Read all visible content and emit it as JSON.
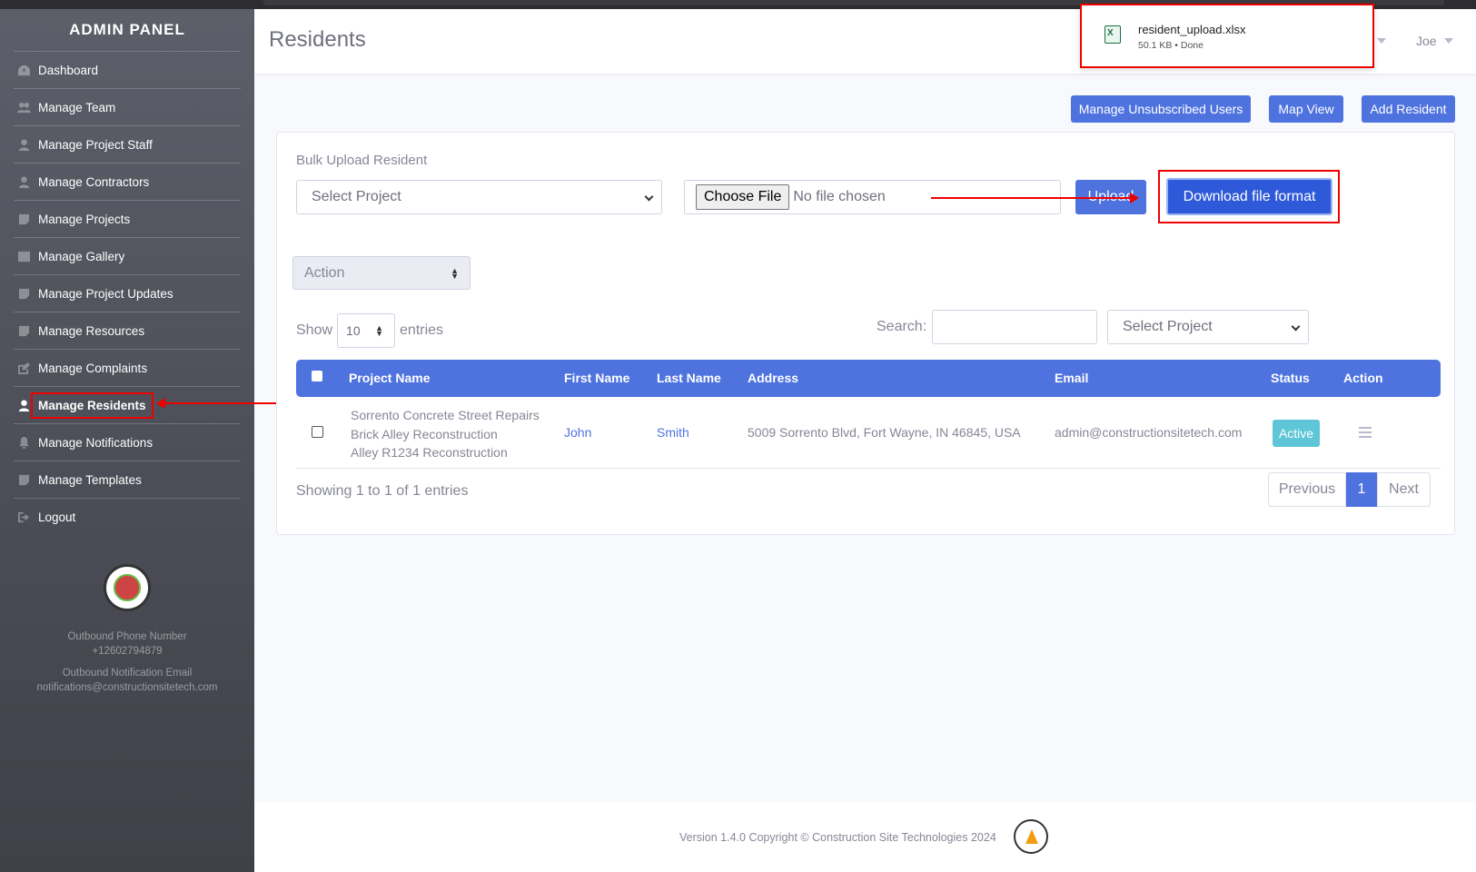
{
  "sidebar": {
    "brand": "ADMIN PANEL",
    "items": [
      {
        "label": "Dashboard",
        "icon": "dashboard-icon"
      },
      {
        "label": "Manage Team",
        "icon": "users-icon"
      },
      {
        "label": "Manage Project Staff",
        "icon": "user-icon"
      },
      {
        "label": "Manage Contractors",
        "icon": "user-icon"
      },
      {
        "label": "Manage Projects",
        "icon": "note-icon"
      },
      {
        "label": "Manage Gallery",
        "icon": "image-icon"
      },
      {
        "label": "Manage Project Updates",
        "icon": "note-icon"
      },
      {
        "label": "Manage Resources",
        "icon": "note-icon"
      },
      {
        "label": "Manage Complaints",
        "icon": "edit-icon"
      },
      {
        "label": "Manage Residents",
        "icon": "user-icon",
        "active": true
      },
      {
        "label": "Manage Notifications",
        "icon": "bell-icon"
      },
      {
        "label": "Manage Templates",
        "icon": "note-icon"
      },
      {
        "label": "Logout",
        "icon": "logout-icon"
      }
    ],
    "phone_label": "Outbound Phone Number",
    "phone": "+12602794879",
    "email_label": "Outbound Notification Email",
    "email": "notifications@constructionsitetech.com"
  },
  "header": {
    "title": "Residents",
    "user": "Joe"
  },
  "download_popup": {
    "filename": "resident_upload.xlsx",
    "meta": "50.1 KB • Done"
  },
  "toolbar": {
    "unsubscribed": "Manage Unsubscribed Users",
    "map": "Map View",
    "add": "Add Resident"
  },
  "bulk": {
    "label": "Bulk Upload Resident",
    "project_placeholder": "Select Project",
    "file_button": "Choose File",
    "file_status": "No file chosen",
    "upload": "Upload",
    "download_format": "Download file format"
  },
  "table_controls": {
    "action": "Action",
    "show": "Show",
    "entries_value": "10",
    "entries": "entries",
    "search_label": "Search:",
    "project_filter": "Select Project"
  },
  "table": {
    "headers": [
      "Project Name",
      "First Name",
      "Last Name",
      "Address",
      "Email",
      "Status",
      "Action"
    ],
    "rows": [
      {
        "projects": [
          "Sorrento Concrete Street Repairs",
          "Brick Alley Reconstruction",
          "Alley R1234 Reconstruction"
        ],
        "first_name": "John",
        "last_name": "Smith",
        "address": "5009 Sorrento Blvd, Fort Wayne, IN 46845, USA",
        "email": "admin@constructionsitetech.com",
        "status": "Active"
      }
    ]
  },
  "pagination": {
    "info": "Showing 1 to 1 of 1 entries",
    "previous": "Previous",
    "current": "1",
    "next": "Next"
  },
  "footer": {
    "text": "Version 1.4.0 Copyright © Construction Site Technologies 2024"
  },
  "colors": {
    "primary": "#4e73df",
    "highlight": "#ee0000",
    "status": "#36b9cc"
  }
}
